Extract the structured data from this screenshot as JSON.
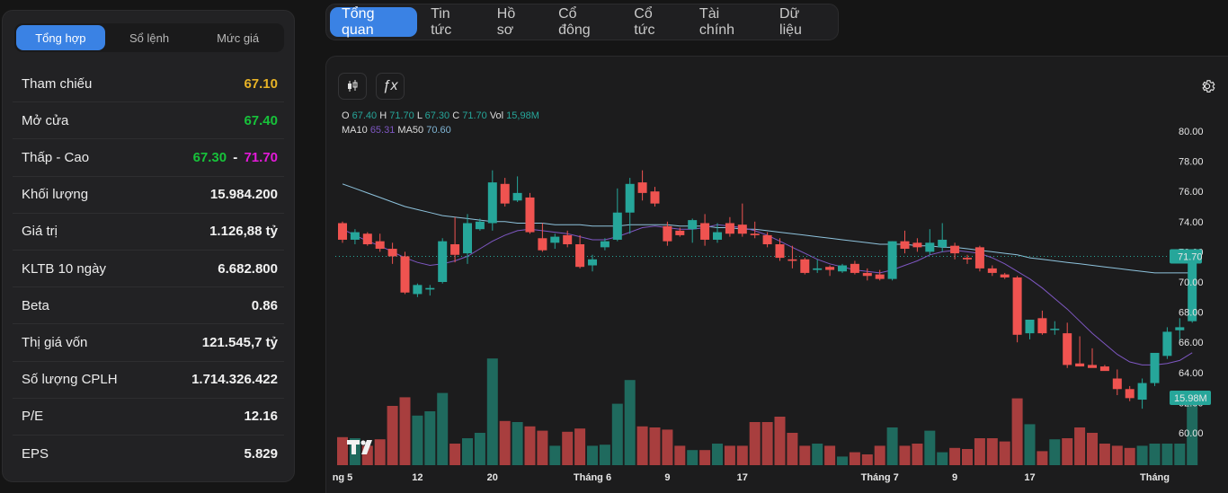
{
  "left_panel": {
    "tabs": [
      {
        "label": "Tổng hợp",
        "active": true
      },
      {
        "label": "Sổ lệnh",
        "active": false
      },
      {
        "label": "Mức giá",
        "active": false
      }
    ],
    "rows": [
      {
        "label": "Tham chiếu",
        "value": "67.10",
        "color": "#e8b326"
      },
      {
        "label": "Mở cửa",
        "value": "67.40",
        "color": "#17c23a"
      },
      {
        "label": "Thấp - Cao",
        "low": "67.30",
        "sep": "-",
        "high": "71.70",
        "low_color": "#17c23a",
        "high_color": "#e31ad8"
      },
      {
        "label": "Khối lượng",
        "value": "15.984.200"
      },
      {
        "label": "Giá trị",
        "value": "1.126,88 tỷ"
      },
      {
        "label": "KLTB 10 ngày",
        "value": "6.682.800"
      },
      {
        "label": "Beta",
        "value": "0.86"
      },
      {
        "label": "Thị giá vốn",
        "value": "121.545,7 tỷ"
      },
      {
        "label": "Số lượng CPLH",
        "value": "1.714.326.422"
      },
      {
        "label": "P/E",
        "value": "12.16"
      },
      {
        "label": "EPS",
        "value": "5.829"
      }
    ]
  },
  "top_tabs": [
    {
      "label": "Tổng quan",
      "active": true
    },
    {
      "label": "Tin tức",
      "active": false
    },
    {
      "label": "Hồ sơ",
      "active": false
    },
    {
      "label": "Cổ đông",
      "active": false
    },
    {
      "label": "Cổ tức",
      "active": false
    },
    {
      "label": "Tài chính",
      "active": false
    },
    {
      "label": "Dữ liệu",
      "active": false
    }
  ],
  "toolbar": {
    "candles_icon": "candlestick-icon",
    "indicator_icon": "function-icon",
    "indicator_label": "ƒx",
    "settings_icon": "gear-icon"
  },
  "legend": {
    "o_label": "O",
    "o": "67.40",
    "h_label": "H",
    "h": "71.70",
    "l_label": "L",
    "l": "67.30",
    "c_label": "C",
    "c": "71.70",
    "vol_label": "Vol",
    "vol": "15,98M",
    "ma10_label": "MA10",
    "ma10": "65.31",
    "ma50_label": "MA50",
    "ma50": "70.60"
  },
  "colors": {
    "up": "#26a69a",
    "down": "#ef5350",
    "vol_up": "#1f6a5e",
    "vol_down": "#a83e3e",
    "ma10": "#7e57c2",
    "ma50": "#8ec3dd",
    "accent": "#3a82e4"
  },
  "chart_data": {
    "type": "candlestick",
    "y_ticks": [
      "80.00",
      "78.00",
      "76.00",
      "74.00",
      "72.00",
      "70.00",
      "68.00",
      "66.00",
      "64.00",
      "62.00",
      "60.00"
    ],
    "ylim": [
      59,
      81.5
    ],
    "x_ticks": [
      {
        "label": "ng 5",
        "index": 0
      },
      {
        "label": "12",
        "index": 6
      },
      {
        "label": "20",
        "index": 12
      },
      {
        "label": "Tháng 6",
        "index": 20
      },
      {
        "label": "9",
        "index": 26
      },
      {
        "label": "17",
        "index": 32
      },
      {
        "label": "Tháng 7",
        "index": 43
      },
      {
        "label": "9",
        "index": 49
      },
      {
        "label": "17",
        "index": 55
      },
      {
        "label": "Tháng",
        "index": 65
      }
    ],
    "last_price_label": "71.70",
    "last_price": 71.7,
    "last_volume_label": "15.98M",
    "candles": [
      [
        73.9,
        74.0,
        72.6,
        72.8
      ],
      [
        72.8,
        73.5,
        72.5,
        73.3
      ],
      [
        73.2,
        73.3,
        72.4,
        72.5
      ],
      [
        72.7,
        73.2,
        72.0,
        72.2
      ],
      [
        72.2,
        72.6,
        71.2,
        71.7
      ],
      [
        71.7,
        72.0,
        69.2,
        69.3
      ],
      [
        69.2,
        69.9,
        69.0,
        69.8
      ],
      [
        69.5,
        69.8,
        69.1,
        69.6
      ],
      [
        70.0,
        72.9,
        69.9,
        72.7
      ],
      [
        72.5,
        74.3,
        71.3,
        71.8
      ],
      [
        71.9,
        74.5,
        71.2,
        73.9
      ],
      [
        73.5,
        74.2,
        73.4,
        74.0
      ],
      [
        73.9,
        77.4,
        73.4,
        76.6
      ],
      [
        76.5,
        76.9,
        75.0,
        75.2
      ],
      [
        75.4,
        77.0,
        75.3,
        75.9
      ],
      [
        75.6,
        75.9,
        73.2,
        73.3
      ],
      [
        72.9,
        73.9,
        72.0,
        72.1
      ],
      [
        72.6,
        73.2,
        72.2,
        73.0
      ],
      [
        73.1,
        73.4,
        72.3,
        72.5
      ],
      [
        72.5,
        73.1,
        70.9,
        71.0
      ],
      [
        71.1,
        71.8,
        70.7,
        71.5
      ],
      [
        72.3,
        72.9,
        72.1,
        72.7
      ],
      [
        72.8,
        76.2,
        72.7,
        74.6
      ],
      [
        74.6,
        76.9,
        73.2,
        76.5
      ],
      [
        76.6,
        77.4,
        75.4,
        75.9
      ],
      [
        76.0,
        76.3,
        75.0,
        75.2
      ],
      [
        73.7,
        74.0,
        72.4,
        72.7
      ],
      [
        73.4,
        73.6,
        73.0,
        73.1
      ],
      [
        73.5,
        74.2,
        72.6,
        74.1
      ],
      [
        73.9,
        74.5,
        72.4,
        72.8
      ],
      [
        72.8,
        73.9,
        72.6,
        73.3
      ],
      [
        73.9,
        74.3,
        73.0,
        73.2
      ],
      [
        73.8,
        75.2,
        73.0,
        73.2
      ],
      [
        73.2,
        74.0,
        72.9,
        73.1
      ],
      [
        73.1,
        73.3,
        72.3,
        72.5
      ],
      [
        72.5,
        72.9,
        71.4,
        71.6
      ],
      [
        71.5,
        72.4,
        70.9,
        71.4
      ],
      [
        71.5,
        71.6,
        70.5,
        70.6
      ],
      [
        70.8,
        71.5,
        70.6,
        70.9
      ],
      [
        71.0,
        71.1,
        70.4,
        70.8
      ],
      [
        70.7,
        71.2,
        70.6,
        71.1
      ],
      [
        71.2,
        71.4,
        70.5,
        70.6
      ],
      [
        70.6,
        70.9,
        70.1,
        70.4
      ],
      [
        70.5,
        70.8,
        70.1,
        70.2
      ],
      [
        70.2,
        72.7,
        70.1,
        72.7
      ],
      [
        72.7,
        73.4,
        71.9,
        72.2
      ],
      [
        72.6,
        72.9,
        72.0,
        72.3
      ],
      [
        72.0,
        73.5,
        71.8,
        72.6
      ],
      [
        72.3,
        73.9,
        72.0,
        72.8
      ],
      [
        72.4,
        72.6,
        71.5,
        71.9
      ],
      [
        71.6,
        71.8,
        71.2,
        71.5
      ],
      [
        72.3,
        72.4,
        70.7,
        70.9
      ],
      [
        70.9,
        71.1,
        70.4,
        70.6
      ],
      [
        70.5,
        70.6,
        70.2,
        70.3
      ],
      [
        70.3,
        70.4,
        66.0,
        66.5
      ],
      [
        66.6,
        67.5,
        66.2,
        67.5
      ],
      [
        67.6,
        68.1,
        66.5,
        66.6
      ],
      [
        66.9,
        67.4,
        66.5,
        66.9
      ],
      [
        66.6,
        67.3,
        64.3,
        64.5
      ],
      [
        64.6,
        66.4,
        64.4,
        64.4
      ],
      [
        64.5,
        65.6,
        64.4,
        64.3
      ],
      [
        64.4,
        64.5,
        64.2,
        64.1
      ],
      [
        63.6,
        64.2,
        62.5,
        62.9
      ],
      [
        62.9,
        63.1,
        62.1,
        62.3
      ],
      [
        62.2,
        63.6,
        61.6,
        63.3
      ],
      [
        63.3,
        65.3,
        63.1,
        65.3
      ],
      [
        65.1,
        67.0,
        64.9,
        66.7
      ],
      [
        66.8,
        67.6,
        66.1,
        67.0
      ],
      [
        67.4,
        71.7,
        67.3,
        71.7
      ]
    ],
    "volumes": [
      2.6,
      2.5,
      1.8,
      2.4,
      5.5,
      6.3,
      4.6,
      5.0,
      6.7,
      2.0,
      2.5,
      3.0,
      9.9,
      4.1,
      4.0,
      3.6,
      3.2,
      1.8,
      3.1,
      3.4,
      1.8,
      1.9,
      5.7,
      7.9,
      3.6,
      3.5,
      3.3,
      1.8,
      1.4,
      1.4,
      2.0,
      1.8,
      1.8,
      4.0,
      4.0,
      4.5,
      3.0,
      1.8,
      2.0,
      1.8,
      0.8,
      1.2,
      1.0,
      1.8,
      3.5,
      1.8,
      2.0,
      3.2,
      1.2,
      1.6,
      1.5,
      2.5,
      2.5,
      2.2,
      6.2,
      3.8,
      1.3,
      2.4,
      2.5,
      3.5,
      3.0,
      2.0,
      1.8,
      1.6,
      1.8,
      2.0,
      2.0,
      2.0,
      6.0
    ],
    "ma10": [
      73.5,
      73.1,
      72.7,
      72.4,
      72.0,
      71.6,
      71.3,
      71.1,
      71.2,
      71.4,
      71.7,
      72.2,
      72.7,
      73.1,
      73.4,
      73.5,
      73.4,
      73.3,
      73.2,
      73.0,
      72.8,
      72.8,
      73.0,
      73.3,
      73.6,
      73.7,
      73.6,
      73.5,
      73.5,
      73.6,
      73.8,
      73.7,
      73.6,
      73.4,
      73.1,
      72.7,
      72.3,
      71.9,
      71.5,
      71.2,
      71.0,
      70.8,
      70.7,
      70.6,
      70.8,
      71.1,
      71.4,
      71.8,
      72.0,
      72.1,
      72.0,
      71.9,
      71.6,
      71.2,
      70.7,
      70.2,
      69.6,
      68.9,
      68.2,
      67.4,
      66.6,
      65.9,
      65.2,
      64.7,
      64.5,
      64.5,
      64.6,
      64.8,
      65.31
    ],
    "ma50": [
      76.5,
      76.2,
      75.9,
      75.6,
      75.3,
      75.0,
      74.8,
      74.6,
      74.4,
      74.3,
      74.2,
      74.1,
      74.0,
      74.0,
      73.9,
      73.9,
      73.9,
      73.8,
      73.8,
      73.8,
      73.7,
      73.7,
      73.7,
      73.8,
      73.8,
      73.8,
      73.8,
      73.7,
      73.7,
      73.7,
      73.6,
      73.6,
      73.5,
      73.5,
      73.4,
      73.3,
      73.2,
      73.1,
      73.0,
      72.9,
      72.8,
      72.7,
      72.6,
      72.5,
      72.5,
      72.5,
      72.4,
      72.4,
      72.3,
      72.3,
      72.2,
      72.1,
      72.0,
      71.9,
      71.8,
      71.6,
      71.5,
      71.4,
      71.3,
      71.2,
      71.1,
      71.0,
      70.9,
      70.8,
      70.7,
      70.6,
      70.6,
      70.6,
      70.6
    ]
  }
}
